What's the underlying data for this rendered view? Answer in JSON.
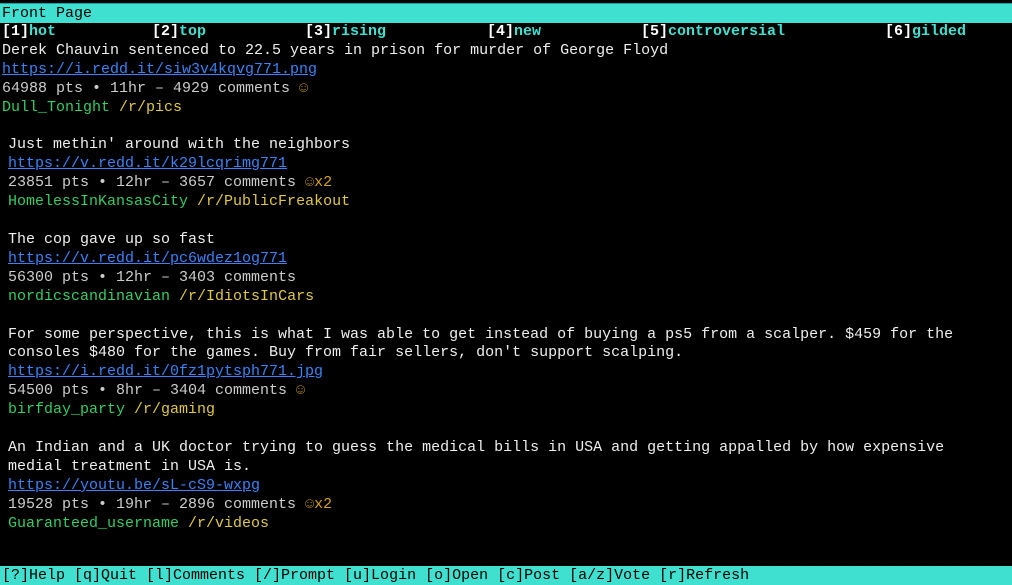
{
  "header": {
    "title": "Front Page"
  },
  "tabs": [
    {
      "key": "[1]",
      "label": "hot"
    },
    {
      "key": "[2]",
      "label": "top"
    },
    {
      "key": "[3]",
      "label": "rising"
    },
    {
      "key": "[4]",
      "label": "new"
    },
    {
      "key": "[5]",
      "label": "controversial"
    },
    {
      "key": "[6]",
      "label": "gilded"
    }
  ],
  "posts": [
    {
      "title": "Derek Chauvin sentenced to 22.5 years in prison for murder of George Floyd",
      "url": "https://i.redd.it/siw3v4kqvg771.png",
      "meta": "64988 pts • 11hr – 4929 comments ",
      "award": "☺",
      "author": "Dull_Tonight",
      "subreddit": "/r/pics"
    },
    {
      "title": "Just methin' around with the neighbors",
      "url": "https://v.redd.it/k29lcqrimg771",
      "meta": "23851 pts • 12hr – 3657 comments ",
      "award": "☺x2",
      "author": "HomelessInKansasCity",
      "subreddit": "/r/PublicFreakout"
    },
    {
      "title": "The cop gave up so fast",
      "url": "https://v.redd.it/pc6wdez1og771",
      "meta": "56300 pts • 12hr – 3403 comments",
      "award": "",
      "author": "nordicscandinavian",
      "subreddit": "/r/IdiotsInCars"
    },
    {
      "title": "For some perspective, this is what I was able to get instead of buying a ps5 from a scalper. $459 for the consoles $480 for the games. Buy from fair sellers, don't support scalping.",
      "url": "https://i.redd.it/0fz1pytsph771.jpg",
      "meta": "54500 pts • 8hr – 3404 comments ",
      "award": "☺",
      "author": "birfday_party",
      "subreddit": "/r/gaming"
    },
    {
      "title": "An Indian and a UK doctor trying to guess the medical bills in USA and getting appalled by how expensive medial treatment in USA is.",
      "url": "https://youtu.be/sL-cS9-wxpg",
      "meta": "19528 pts • 19hr – 2896 comments ",
      "award": "☺x2",
      "author": "Guaranteed_username",
      "subreddit": "/r/videos"
    }
  ],
  "footer": "[?]Help [q]Quit [l]Comments [/]Prompt [u]Login [o]Open [c]Post [a/z]Vote [r]Refresh"
}
